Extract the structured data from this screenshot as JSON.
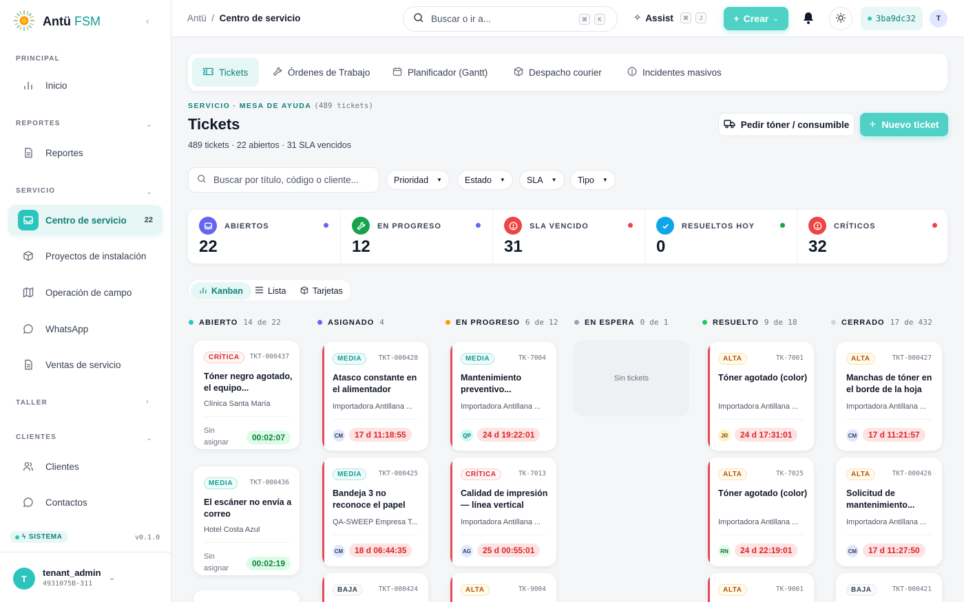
{
  "brand": {
    "name": "Antü",
    "suffix": "FSM"
  },
  "sidebar": {
    "sections": [
      {
        "label": "PRINCIPAL"
      },
      {
        "label": "REPORTES"
      },
      {
        "label": "SERVICIO"
      },
      {
        "label": "TALLER"
      },
      {
        "label": "CLIENTES"
      }
    ],
    "items": [
      {
        "label": "Inicio"
      },
      {
        "label": "Reportes"
      },
      {
        "label": "Centro de servicio",
        "count": "22"
      },
      {
        "label": "Proyectos de instalación"
      },
      {
        "label": "Operación de campo"
      },
      {
        "label": "WhatsApp"
      },
      {
        "label": "Ventas de servicio"
      },
      {
        "label": "Clientes"
      },
      {
        "label": "Contactos"
      }
    ],
    "system_badge": "SISTEMA",
    "version": "v0.1.0",
    "user": {
      "name": "tenant_admin",
      "id": "4931075B-311",
      "initial": "T"
    }
  },
  "topbar": {
    "breadcrumb_root": "Antü",
    "breadcrumb_sep": "/",
    "breadcrumb_current": "Centro de servicio",
    "search_placeholder": "Buscar o ir a...",
    "search_kbd": [
      "⌘",
      "K"
    ],
    "assist_label": "Assist",
    "assist_kbd": [
      "⌘",
      "J"
    ],
    "create_label": "Crear",
    "commit_hash": "3ba9dc32",
    "avatar": "T"
  },
  "tabs": [
    {
      "label": "Tickets"
    },
    {
      "label": "Órdenes de Trabajo"
    },
    {
      "label": "Planificador (Gantt)"
    },
    {
      "label": "Despacho courier"
    },
    {
      "label": "Incidentes masivos"
    }
  ],
  "header": {
    "eyebrow": "SERVICIO · MESA DE AYUDA",
    "eyebrow_count": "(489 tickets)",
    "title": "Tickets",
    "subtitle": "489 tickets · 22 abiertos · 31 SLA vencidos",
    "toner_button": "Pedir tóner / consumible",
    "new_button": "Nuevo ticket"
  },
  "filters": {
    "search_placeholder": "Buscar por título, código o cliente...",
    "chips": [
      "Prioridad",
      "Estado",
      "SLA",
      "Tipo"
    ]
  },
  "stats": [
    {
      "label": "ABIERTOS",
      "value": "22",
      "color": "#6366f1"
    },
    {
      "label": "EN PROGRESO",
      "value": "12",
      "color": "#16a34a"
    },
    {
      "label": "SLA VENCIDO",
      "value": "31",
      "color": "#ef4444"
    },
    {
      "label": "RESUELTOS HOY",
      "value": "0",
      "color": "#0ea5e9"
    },
    {
      "label": "CRÍTICOS",
      "value": "32",
      "color": "#ef4444"
    }
  ],
  "views": [
    "Kanban",
    "Lista",
    "Tarjetas"
  ],
  "columns": [
    {
      "label": "ABIERTO",
      "count": "14 de 22",
      "color": "#2cc5bd"
    },
    {
      "label": "ASIGNADO",
      "count": "4",
      "color": "#6366f1"
    },
    {
      "label": "EN PROGRESO",
      "count": "6 de 12",
      "color": "#f59e0b"
    },
    {
      "label": "EN ESPERA",
      "count": "0 de 1",
      "color": "#9ca3af"
    },
    {
      "label": "RESUELTO",
      "count": "9 de 18",
      "color": "#22c55e"
    },
    {
      "label": "CERRADO",
      "count": "17 de 432",
      "color": "#d1d5db"
    }
  ],
  "empty_column_text": "Sin tickets",
  "unassigned_label": "Sin asignar",
  "tickets": {
    "abierto": [
      {
        "priority": "CRÍTICA",
        "code": "TKT-000437",
        "title": "Tóner negro agotado, el equipo...",
        "client": "Clínica Santa María",
        "timer": "00:02:07"
      },
      {
        "priority": "MEDIA",
        "code": "TKT-000436",
        "title": "El escáner no envía a correo",
        "client": "Hotel Costa Azul",
        "timer": "00:02:19"
      }
    ],
    "asignado": [
      {
        "priority": "MEDIA",
        "code": "TKT-000428",
        "title": "Atasco constante en el alimentador",
        "client": "Importadora Antillana ...",
        "assignee": "CM",
        "sla": "17 d 11:18:55"
      },
      {
        "priority": "MEDIA",
        "code": "TKT-000425",
        "title": "Bandeja 3 no reconoce el papel",
        "client": "QA-SWEEP Empresa T...",
        "assignee": "CM",
        "sla": "18 d 06:44:35"
      },
      {
        "priority": "BAJA",
        "code": "TKT-000424"
      }
    ],
    "en_progreso": [
      {
        "priority": "MEDIA",
        "code": "TK-7004",
        "title": "Mantenimiento preventivo...",
        "client": "Importadora Antillana ...",
        "assignee": "QP",
        "sla": "24 d 19:22:01"
      },
      {
        "priority": "CRÍTICA",
        "code": "TK-7013",
        "title": "Calidad de impresión — línea vertical",
        "client": "Importadora Antillana ...",
        "assignee": "AG",
        "sla": "25 d 00:55:01"
      },
      {
        "priority": "ALTA",
        "code": "TK-9004"
      }
    ],
    "resuelto": [
      {
        "priority": "ALTA",
        "code": "TK-7001",
        "title": "Tóner agotado (color)",
        "client": "Importadora Antillana ...",
        "assignee": "JR",
        "sla": "24 d 17:31:01"
      },
      {
        "priority": "ALTA",
        "code": "TK-7025",
        "title": "Tóner agotado (color)",
        "client": "Importadora Antillana ...",
        "assignee": "RN",
        "sla": "24 d 22:19:01"
      },
      {
        "priority": "ALTA",
        "code": "TK-9001"
      }
    ],
    "cerrado": [
      {
        "priority": "ALTA",
        "code": "TKT-000427",
        "title": "Manchas de tóner en el borde de la hoja",
        "client": "Importadora Antillana ...",
        "assignee": "CM",
        "sla": "17 d 11:21:57"
      },
      {
        "priority": "ALTA",
        "code": "TKT-000426",
        "title": "Solicitud de mantenimiento...",
        "client": "Importadora Antillana ...",
        "assignee": "CM",
        "sla": "17 d 11:27:50"
      },
      {
        "priority": "BAJA",
        "code": "TKT-000421"
      }
    ]
  }
}
